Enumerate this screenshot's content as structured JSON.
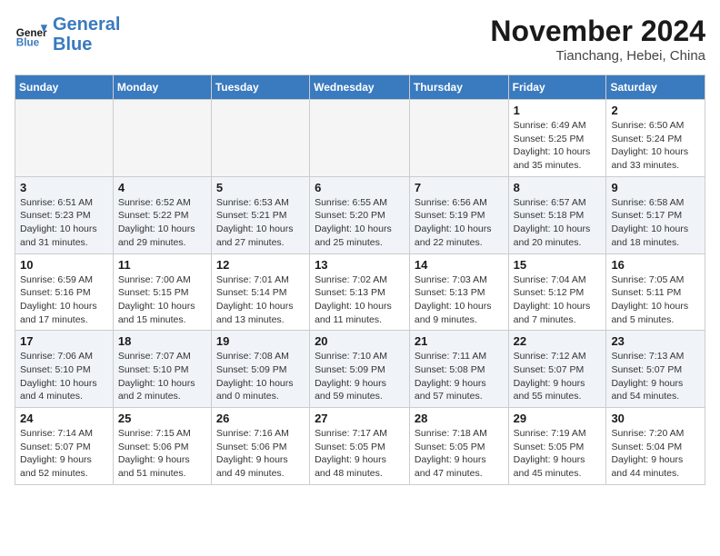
{
  "header": {
    "logo_line1": "General",
    "logo_line2": "Blue",
    "month_title": "November 2024",
    "location": "Tianchang, Hebei, China"
  },
  "weekdays": [
    "Sunday",
    "Monday",
    "Tuesday",
    "Wednesday",
    "Thursday",
    "Friday",
    "Saturday"
  ],
  "weeks": [
    [
      {
        "day": "",
        "info": ""
      },
      {
        "day": "",
        "info": ""
      },
      {
        "day": "",
        "info": ""
      },
      {
        "day": "",
        "info": ""
      },
      {
        "day": "",
        "info": ""
      },
      {
        "day": "1",
        "info": "Sunrise: 6:49 AM\nSunset: 5:25 PM\nDaylight: 10 hours and 35 minutes."
      },
      {
        "day": "2",
        "info": "Sunrise: 6:50 AM\nSunset: 5:24 PM\nDaylight: 10 hours and 33 minutes."
      }
    ],
    [
      {
        "day": "3",
        "info": "Sunrise: 6:51 AM\nSunset: 5:23 PM\nDaylight: 10 hours and 31 minutes."
      },
      {
        "day": "4",
        "info": "Sunrise: 6:52 AM\nSunset: 5:22 PM\nDaylight: 10 hours and 29 minutes."
      },
      {
        "day": "5",
        "info": "Sunrise: 6:53 AM\nSunset: 5:21 PM\nDaylight: 10 hours and 27 minutes."
      },
      {
        "day": "6",
        "info": "Sunrise: 6:55 AM\nSunset: 5:20 PM\nDaylight: 10 hours and 25 minutes."
      },
      {
        "day": "7",
        "info": "Sunrise: 6:56 AM\nSunset: 5:19 PM\nDaylight: 10 hours and 22 minutes."
      },
      {
        "day": "8",
        "info": "Sunrise: 6:57 AM\nSunset: 5:18 PM\nDaylight: 10 hours and 20 minutes."
      },
      {
        "day": "9",
        "info": "Sunrise: 6:58 AM\nSunset: 5:17 PM\nDaylight: 10 hours and 18 minutes."
      }
    ],
    [
      {
        "day": "10",
        "info": "Sunrise: 6:59 AM\nSunset: 5:16 PM\nDaylight: 10 hours and 17 minutes."
      },
      {
        "day": "11",
        "info": "Sunrise: 7:00 AM\nSunset: 5:15 PM\nDaylight: 10 hours and 15 minutes."
      },
      {
        "day": "12",
        "info": "Sunrise: 7:01 AM\nSunset: 5:14 PM\nDaylight: 10 hours and 13 minutes."
      },
      {
        "day": "13",
        "info": "Sunrise: 7:02 AM\nSunset: 5:13 PM\nDaylight: 10 hours and 11 minutes."
      },
      {
        "day": "14",
        "info": "Sunrise: 7:03 AM\nSunset: 5:13 PM\nDaylight: 10 hours and 9 minutes."
      },
      {
        "day": "15",
        "info": "Sunrise: 7:04 AM\nSunset: 5:12 PM\nDaylight: 10 hours and 7 minutes."
      },
      {
        "day": "16",
        "info": "Sunrise: 7:05 AM\nSunset: 5:11 PM\nDaylight: 10 hours and 5 minutes."
      }
    ],
    [
      {
        "day": "17",
        "info": "Sunrise: 7:06 AM\nSunset: 5:10 PM\nDaylight: 10 hours and 4 minutes."
      },
      {
        "day": "18",
        "info": "Sunrise: 7:07 AM\nSunset: 5:10 PM\nDaylight: 10 hours and 2 minutes."
      },
      {
        "day": "19",
        "info": "Sunrise: 7:08 AM\nSunset: 5:09 PM\nDaylight: 10 hours and 0 minutes."
      },
      {
        "day": "20",
        "info": "Sunrise: 7:10 AM\nSunset: 5:09 PM\nDaylight: 9 hours and 59 minutes."
      },
      {
        "day": "21",
        "info": "Sunrise: 7:11 AM\nSunset: 5:08 PM\nDaylight: 9 hours and 57 minutes."
      },
      {
        "day": "22",
        "info": "Sunrise: 7:12 AM\nSunset: 5:07 PM\nDaylight: 9 hours and 55 minutes."
      },
      {
        "day": "23",
        "info": "Sunrise: 7:13 AM\nSunset: 5:07 PM\nDaylight: 9 hours and 54 minutes."
      }
    ],
    [
      {
        "day": "24",
        "info": "Sunrise: 7:14 AM\nSunset: 5:07 PM\nDaylight: 9 hours and 52 minutes."
      },
      {
        "day": "25",
        "info": "Sunrise: 7:15 AM\nSunset: 5:06 PM\nDaylight: 9 hours and 51 minutes."
      },
      {
        "day": "26",
        "info": "Sunrise: 7:16 AM\nSunset: 5:06 PM\nDaylight: 9 hours and 49 minutes."
      },
      {
        "day": "27",
        "info": "Sunrise: 7:17 AM\nSunset: 5:05 PM\nDaylight: 9 hours and 48 minutes."
      },
      {
        "day": "28",
        "info": "Sunrise: 7:18 AM\nSunset: 5:05 PM\nDaylight: 9 hours and 47 minutes."
      },
      {
        "day": "29",
        "info": "Sunrise: 7:19 AM\nSunset: 5:05 PM\nDaylight: 9 hours and 45 minutes."
      },
      {
        "day": "30",
        "info": "Sunrise: 7:20 AM\nSunset: 5:04 PM\nDaylight: 9 hours and 44 minutes."
      }
    ]
  ]
}
